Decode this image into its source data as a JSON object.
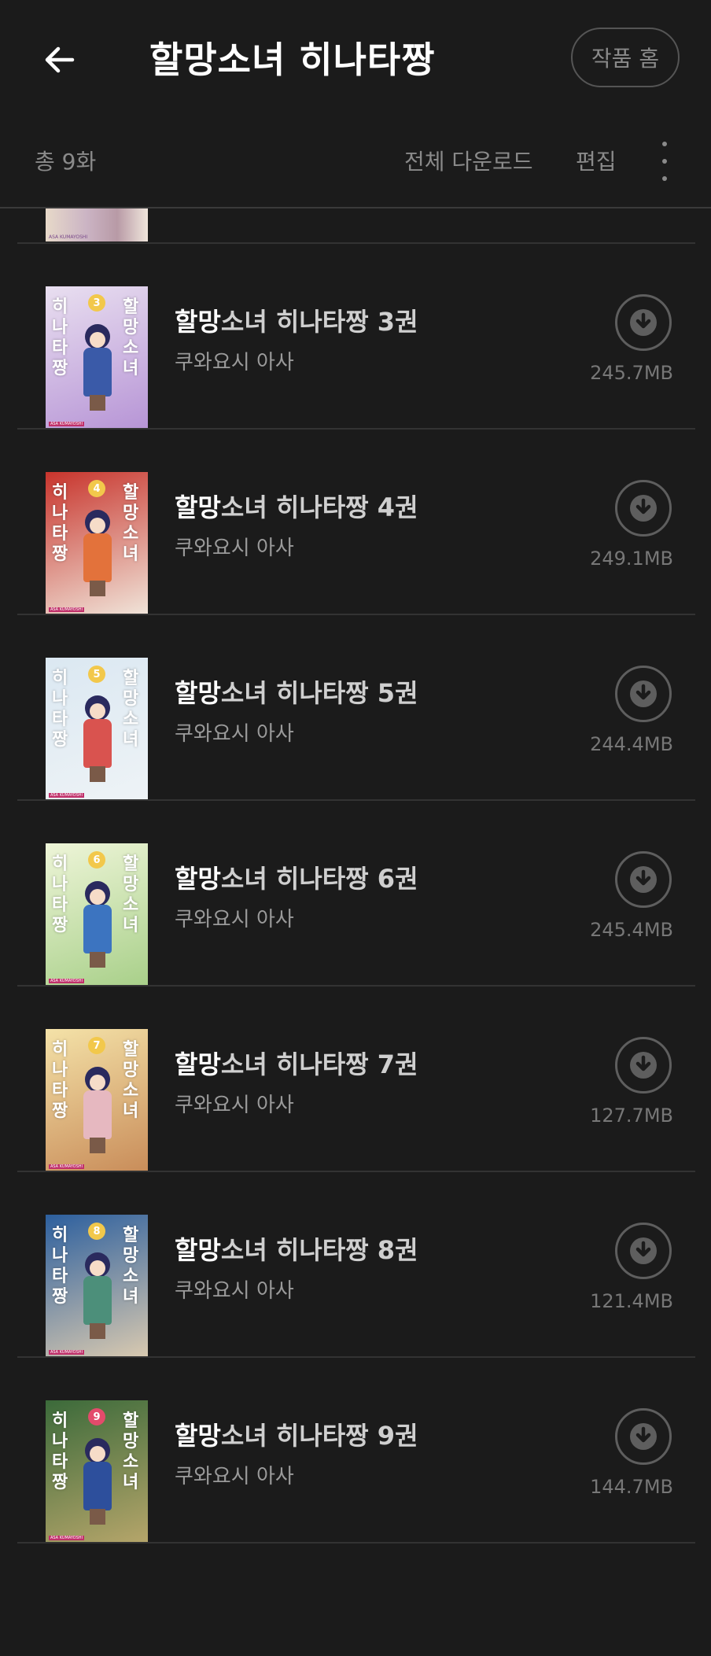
{
  "header": {
    "title": "할망소녀 히나타짱",
    "home_label": "작품 홈"
  },
  "toolbar": {
    "total_label": "총 9화",
    "download_all_label": "전체 다운로드",
    "edit_label": "편집"
  },
  "partial_item": {
    "cover_author": "ASA KUMAYOSHI"
  },
  "items": [
    {
      "title_highlight": "할망",
      "title_rest": "소녀 히나타짱 3권",
      "author": "쿠와요시 아사",
      "size": "245.7MB",
      "cover": {
        "volume": "3",
        "bg": "#e9dff0",
        "bg2": "#b795d6",
        "body": "#3a5aa8",
        "badge": "#f2c84b",
        "title_left": "히나타짱",
        "title_right": "할망소녀",
        "author_tag": "ASA KUMAYOSHI"
      }
    },
    {
      "title_highlight": "할망",
      "title_rest": "소녀 히나타짱 4권",
      "author": "쿠와요시 아사",
      "size": "249.1MB",
      "cover": {
        "volume": "4",
        "bg": "#c8342c",
        "bg2": "#f0e3d8",
        "body": "#e3723b",
        "badge": "#f2c84b",
        "title_left": "히나타짱",
        "title_right": "할망소녀",
        "author_tag": "ASA KUMAYOSHI"
      }
    },
    {
      "title_highlight": "할망",
      "title_rest": "소녀 히나타짱 5권",
      "author": "쿠와요시 아사",
      "size": "244.4MB",
      "cover": {
        "volume": "5",
        "bg": "#dbe8f2",
        "bg2": "#eef3f6",
        "body": "#d9534f",
        "badge": "#f2c84b",
        "title_left": "히나타짱",
        "title_right": "할망소녀",
        "author_tag": "ASA KUMAYOSHI"
      }
    },
    {
      "title_highlight": "할망",
      "title_rest": "소녀 히나타짱 6권",
      "author": "쿠와요시 아사",
      "size": "245.4MB",
      "cover": {
        "volume": "6",
        "bg": "#eef5d8",
        "bg2": "#a9d08a",
        "body": "#3c74c0",
        "badge": "#f2c84b",
        "title_left": "히나타짱",
        "title_right": "할망소녀",
        "author_tag": "ASA KUMAYOSHI"
      }
    },
    {
      "title_highlight": "할망",
      "title_rest": "소녀 히나타짱 7권",
      "author": "쿠와요시 아사",
      "size": "127.7MB",
      "cover": {
        "volume": "7",
        "bg": "#f4e2a8",
        "bg2": "#c98d5a",
        "body": "#e6b8c0",
        "badge": "#f2c84b",
        "title_left": "히나타짱",
        "title_right": "할망소녀",
        "author_tag": "ASA KUMAYOSHI"
      }
    },
    {
      "title_highlight": "할망",
      "title_rest": "소녀 히나타짱 8권",
      "author": "쿠와요시 아사",
      "size": "121.4MB",
      "cover": {
        "volume": "8",
        "bg": "#2c5f9e",
        "bg2": "#d8c9b0",
        "body": "#4c8f7a",
        "badge": "#f2c84b",
        "title_left": "히나타짱",
        "title_right": "할망소녀",
        "author_tag": "ASA KUMAYOSHI"
      }
    },
    {
      "title_highlight": "할망",
      "title_rest": "소녀 히나타짱 9권",
      "author": "쿠와요시 아사",
      "size": "144.7MB",
      "cover": {
        "volume": "9",
        "bg": "#3b6a3a",
        "bg2": "#b5a56a",
        "body": "#2d4f9c",
        "badge": "#e34b6b",
        "title_left": "히나타짱",
        "title_right": "할망소녀",
        "author_tag": "ASA KUMAYOSHI"
      }
    }
  ],
  "colors": {
    "background": "#1b1b1b",
    "divider": "#333333",
    "muted_text": "#8a8a8a",
    "icon_gray": "#5e5e5e"
  },
  "icons": {
    "back": "arrow-left-icon",
    "more": "more-vertical-icon",
    "download": "download-circle-icon"
  }
}
